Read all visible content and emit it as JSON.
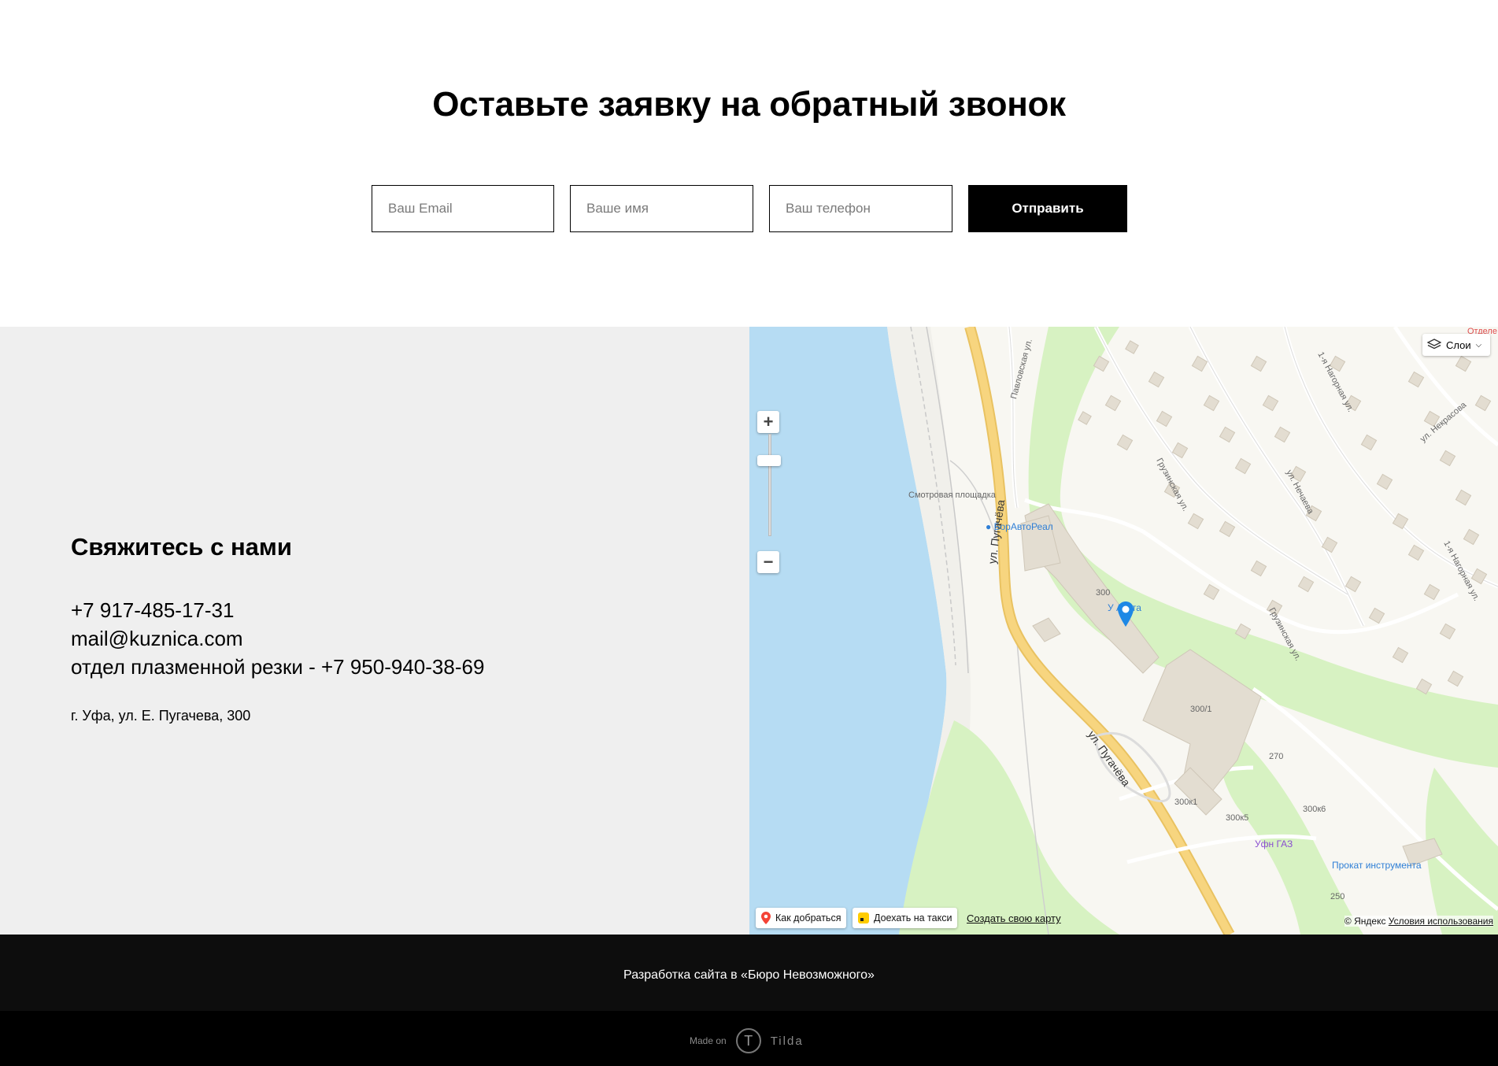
{
  "callback": {
    "title": "Оставьте заявку на обратный звонок",
    "email_placeholder": "Ваш Email",
    "name_placeholder": "Ваше имя",
    "phone_placeholder": "Ваш телефон",
    "submit_label": "Отправить"
  },
  "contacts": {
    "title": "Свяжитесь с нами",
    "phone": "+7 917-485-17-31",
    "email": "mail@kuznica.com",
    "plasma_phone": "отдел плазменной резки - +7 950-940-38-69",
    "address": "г. Уфа, ул. Е. Пугачева, 300"
  },
  "map": {
    "layers_label": "Слои",
    "route_label": "Как добраться",
    "taxi_label": "Доехать на такси",
    "create_map_label": "Создать свою карту",
    "copyright": "© Яндекс",
    "terms_label": "Условия использования",
    "colors": {
      "water": "#b6dcf3",
      "park": "#d7f2c2",
      "road": "#f7d57f",
      "building": "#e3ddd1"
    },
    "labels": {
      "street_main_1": "ул. Пугачёва",
      "street_main_2": "ул. Пугачёва",
      "viewpoint": "Смотровая площадка",
      "poi_borauto": "БорАвтоРеал",
      "poi_uazata": "У Азата",
      "poi_gas": "Уфн ГАЗ",
      "poi_rent": "Прокат инструмента",
      "street_pavlovskaya": "Павловская ул.",
      "street_gruzinskaya_1": "Грузинская ул.",
      "street_gruzinskaya_2": "Грузинская ул.",
      "street_nechaeva": "ул. Нечаева",
      "street_nagornaya_1": "1-я Нагорная ул.",
      "street_nagornaya_2": "1-я Нагорная ул.",
      "street_nekrasova": "ул. Некрасова",
      "bld_300": "300",
      "bld_300_1": "300/1",
      "bld_300k1": "300к1",
      "bld_300k5": "300к5",
      "bld_300k6": "300к6",
      "bld_270": "270",
      "bld_250": "250",
      "otdel": "Отделе"
    }
  },
  "footer": {
    "dev_text": "Разработка сайта в «Бюро Невозможного»",
    "made_on": "Made on",
    "tilda_word": "Tilda"
  }
}
